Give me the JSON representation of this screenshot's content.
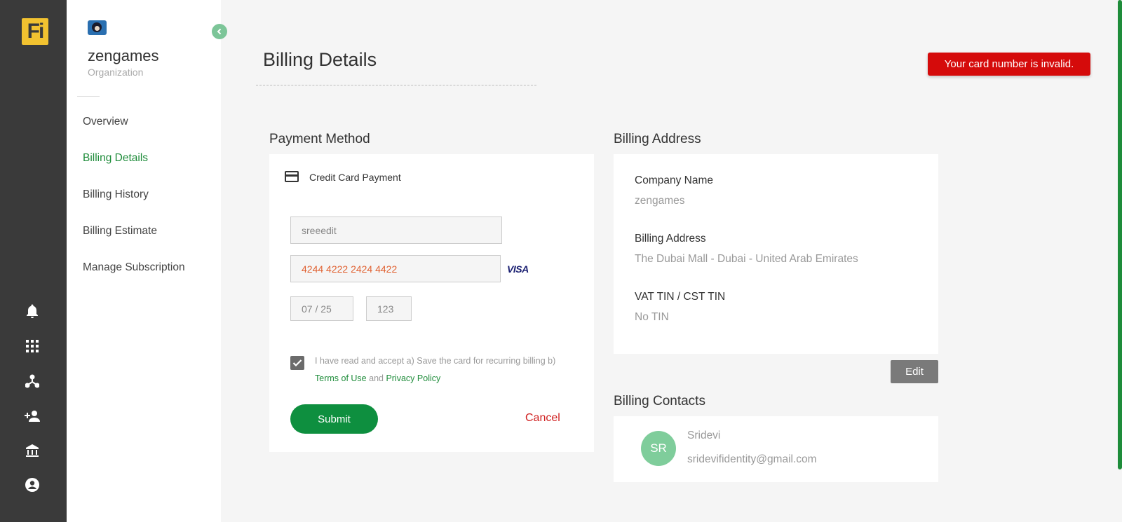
{
  "app": {
    "logo_text": "Fi"
  },
  "rail": {
    "icons": [
      "bell-icon",
      "grid-icon",
      "network-icon",
      "add-person-icon",
      "bank-icon",
      "account-circle-icon"
    ]
  },
  "org": {
    "name": "zengames",
    "type": "Organization"
  },
  "nav": {
    "items": [
      {
        "label": "Overview"
      },
      {
        "label": "Billing Details"
      },
      {
        "label": "Billing History"
      },
      {
        "label": "Billing Estimate"
      },
      {
        "label": "Manage Subscription"
      }
    ],
    "active": "Billing Details"
  },
  "page": {
    "title": "Billing Details",
    "error_message": "Your card number is invalid."
  },
  "payment_method": {
    "section_title": "Payment Method",
    "type_label": "Credit Card Payment",
    "cardholder_name": "sreeedit",
    "card_number": "4244 4222 2424 4422",
    "card_brand": "VISA",
    "expiry": "07 / 25",
    "cvc": "123",
    "consent_text": "I have read and accept a) Save the card for recurring billing b) ",
    "terms_link": "Terms of Use",
    "consent_and": " and ",
    "privacy_link": "Privacy Policy",
    "consent_checked": true,
    "submit_label": "Submit",
    "cancel_label": "Cancel"
  },
  "billing_address": {
    "section_title": "Billing Address",
    "company_label": "Company Name",
    "company_value": "zengames",
    "address_label": "Billing Address",
    "address_value": "The Dubai Mall - Dubai - United Arab Emirates",
    "tin_label": "VAT TIN / CST TIN",
    "tin_value": "No TIN",
    "edit_label": "Edit"
  },
  "billing_contacts": {
    "section_title": "Billing Contacts",
    "contacts": [
      {
        "initials": "SR",
        "name": "Sridevi",
        "email": "sridevifidentity@gmail.com"
      }
    ]
  },
  "colors": {
    "accent": "#1e8c3a",
    "submit": "#0e8f3f",
    "error": "#d50b0b",
    "rail": "#3a3a3a",
    "logo": "#f2c230"
  }
}
